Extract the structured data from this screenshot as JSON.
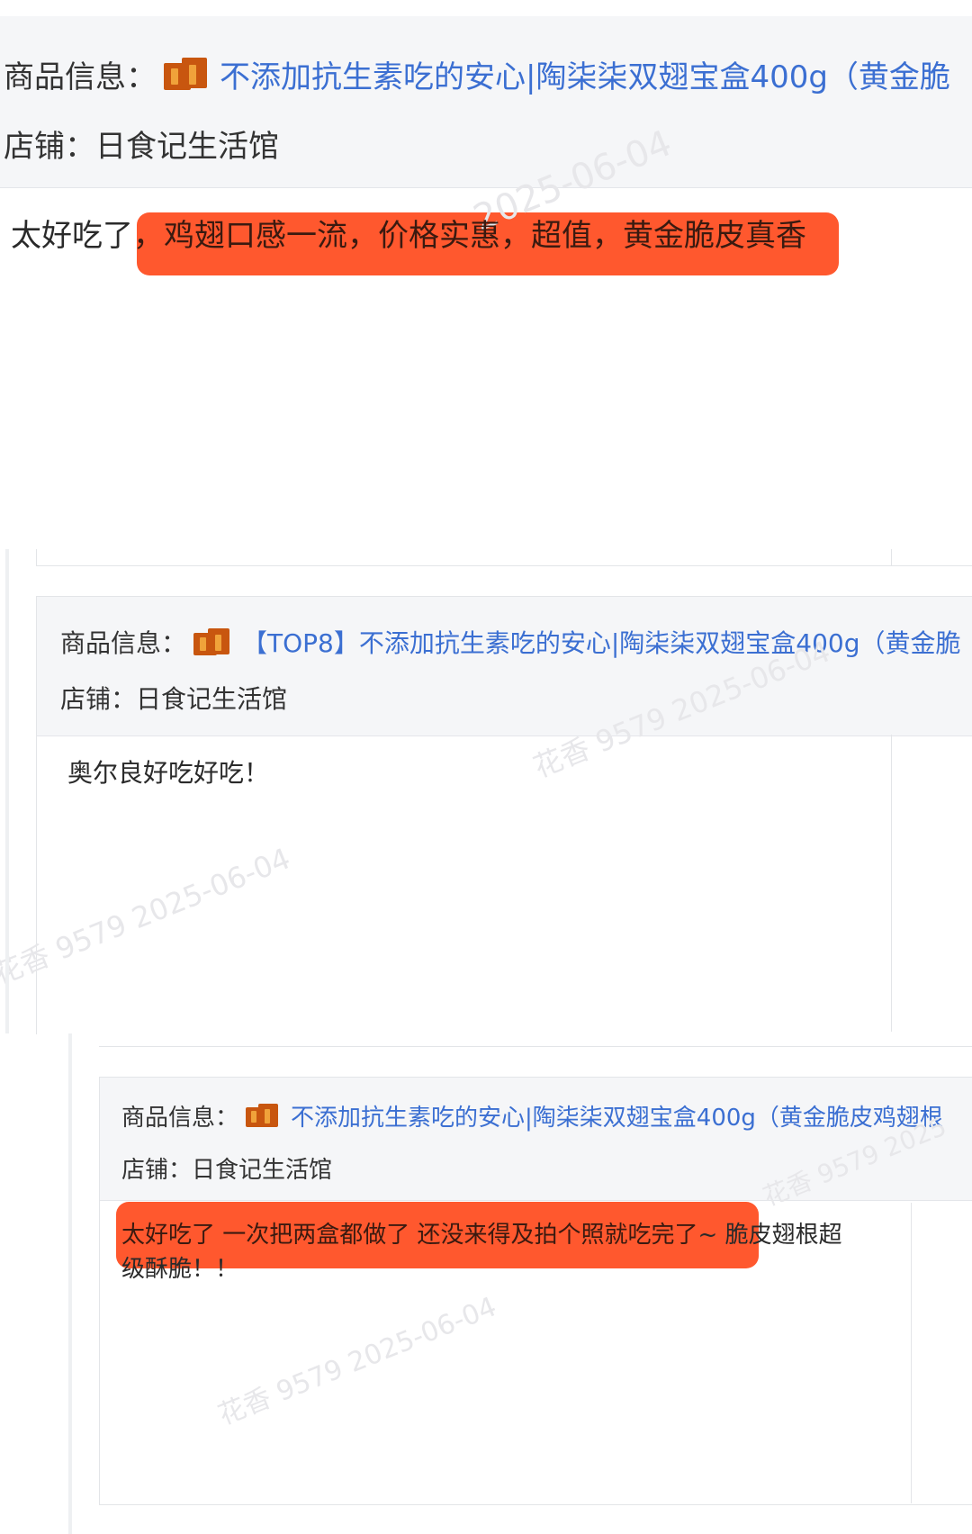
{
  "review1": {
    "product_label": "商品信息：",
    "product_title": "不添加抗生素吃的安心|陶柒柒双翅宝盒400g（黄金脆",
    "shop_label": "店铺：",
    "shop_name": "日食记生活馆",
    "comment_prefix": "太好吃了",
    "comment_highlight": "，鸡翅口感一流，价格实惠，超值，黄金脆皮真香",
    "watermark": "2025-06-04"
  },
  "review2": {
    "product_label": "商品信息：",
    "product_title": "【TOP8】不添加抗生素吃的安心|陶柒柒双翅宝盒400g（黄金脆",
    "shop_label": "店铺：",
    "shop_name": "日食记生活馆",
    "comment": "奥尔良好吃好吃！",
    "watermark": "花香 9579 2025-06-04",
    "watermark2": "花香 9579 2025-06-04"
  },
  "review3": {
    "product_label": "商品信息：",
    "product_title": "不添加抗生素吃的安心|陶柒柒双翅宝盒400g（黄金脆皮鸡翅根",
    "shop_label": "店铺：",
    "shop_name": "日食记生活馆",
    "comment_highlight": "太好吃了 一次把两盒都做了 还没来得及拍个照就吃完了",
    "comment_rest_line1": "~ 脆皮翅根超",
    "comment_line2": "级酥脆！！",
    "watermark": "花香 9579 2025-06-04",
    "watermark2": "花香 9579 2025"
  },
  "colors": {
    "highlight": "#ff4a1c",
    "link": "#3b6fd2",
    "header_bg": "#f5f6f8"
  }
}
